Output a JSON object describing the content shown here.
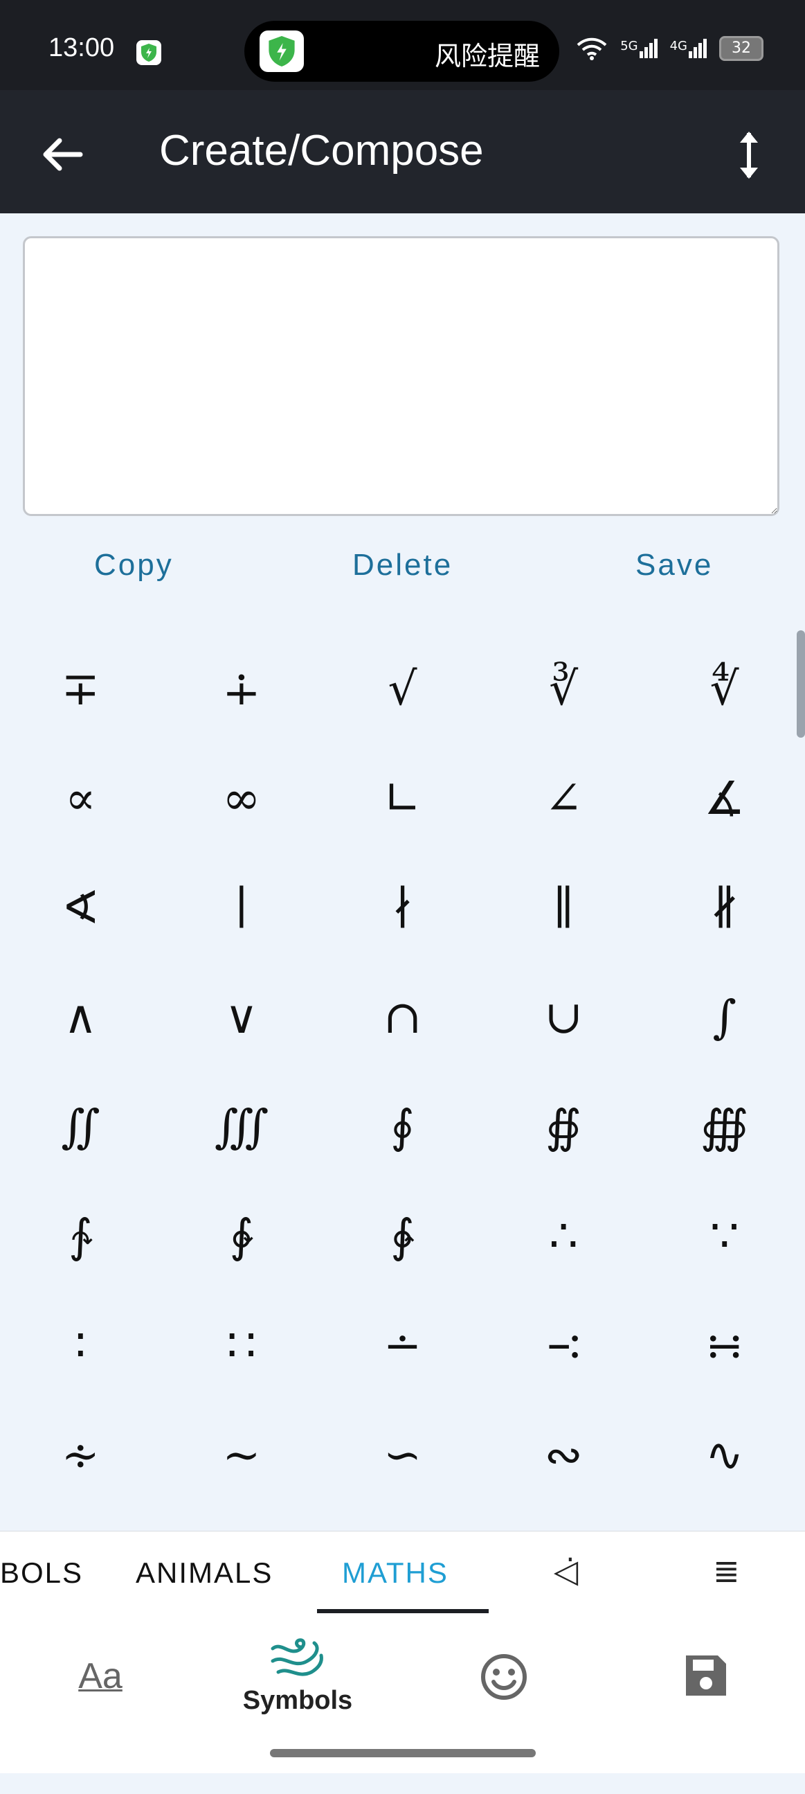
{
  "status_bar": {
    "time": "13:00",
    "alert_text": "风险提醒",
    "battery": "32",
    "network_labels": [
      "5G",
      "4G"
    ]
  },
  "app_bar": {
    "title": "Create/Compose"
  },
  "compose": {
    "value": "",
    "placeholder": ""
  },
  "actions": {
    "copy": "Copy",
    "delete": "Delete",
    "save": "Save"
  },
  "symbols": [
    "∓",
    "∔",
    "√",
    "∛",
    "∜",
    "∝",
    "∞",
    "∟",
    "∠",
    "∡",
    "∢",
    "∣",
    "∤",
    "∥",
    "∦",
    "∧",
    "∨",
    "∩",
    "∪",
    "∫",
    "∬",
    "∭",
    "∮",
    "∯",
    "∰",
    "∱",
    "∲",
    "∳",
    "∴",
    "∵",
    "∶",
    "∷",
    "∸",
    "∹",
    "∺",
    "∻",
    "∼",
    "∽",
    "∾",
    "∿"
  ],
  "tabs": {
    "items": [
      "BOLS",
      "ANIMALS",
      "MATHS"
    ],
    "active": "MATHS",
    "icon_tab_1": "◁̇",
    "icon_tab_2": "≣"
  },
  "bottom_nav": {
    "fonts_icon_text": "Aa",
    "symbols_label": "Symbols",
    "colors": {
      "accent": "#1f9ed3",
      "symbols_icon": "#1f8f8c",
      "action_text": "#1d6f9a"
    }
  }
}
